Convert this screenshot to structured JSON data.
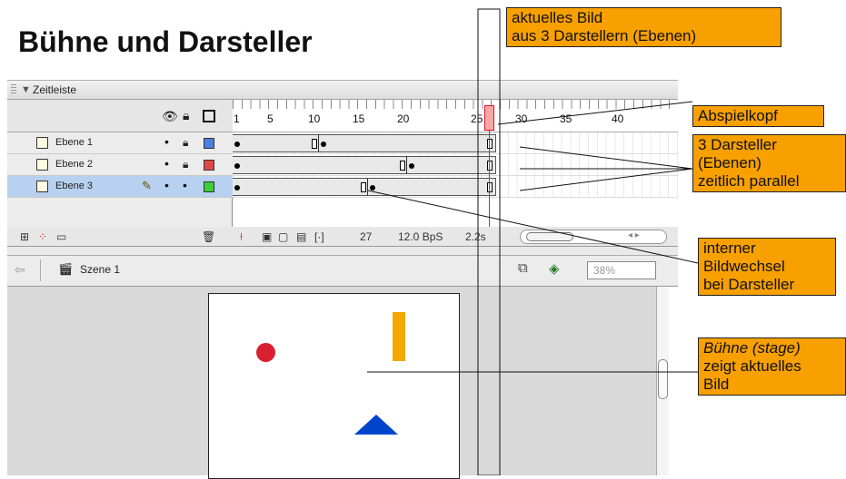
{
  "title": "Bühne und Darsteller",
  "panel": {
    "title": "Zeitleiste",
    "header_icons": [
      "eye-icon",
      "lock-icon",
      "outline-icon"
    ],
    "ruler_numbers": [
      "1",
      "5",
      "10",
      "15",
      "20",
      "25",
      "30",
      "35",
      "40"
    ],
    "layers": [
      {
        "name": "Ebene 1",
        "color": "#4a7fe0",
        "selected": false
      },
      {
        "name": "Ebene 2",
        "color": "#e04848",
        "selected": false
      },
      {
        "name": "Ebene 3",
        "color": "#3ccf3c",
        "selected": true
      }
    ],
    "status": {
      "frame": "27",
      "fps": "12.0 BpS",
      "time": "2.2s"
    },
    "playhead_frame": 27
  },
  "scene": {
    "label": "Szene 1",
    "zoom": "38%"
  },
  "stage_shapes": {
    "circle_color": "#d92030",
    "bar_color": "#f2a800",
    "triangle_color": "#0044cc"
  },
  "annotations": {
    "current_frame": [
      "aktuelles Bild",
      "aus 3 Darstellern (Ebenen)"
    ],
    "playhead": [
      "Abspielkopf"
    ],
    "actors": [
      "3 Darsteller",
      "(Ebenen)",
      "zeitlich parallel"
    ],
    "internal": [
      "interner",
      "Bildwechsel",
      "bei Darsteller"
    ],
    "stage_italic": "Bühne (stage)",
    "stage": [
      "zeigt aktuelles",
      "Bild"
    ]
  }
}
